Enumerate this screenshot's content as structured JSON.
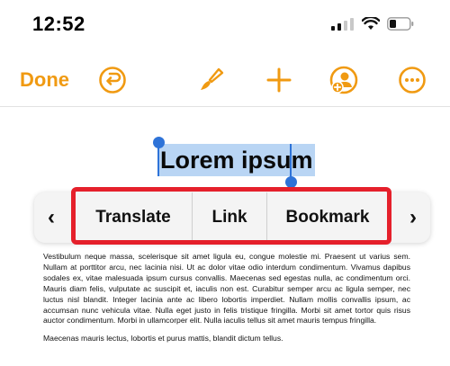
{
  "status_bar": {
    "time": "12:52"
  },
  "toolbar": {
    "done_label": "Done"
  },
  "document": {
    "title": "Lorem ipsum",
    "paragraphs": [
      "Vestibulum neque massa, scelerisque sit amet ligula eu, congue molestie mi. Praesent ut varius sem. Nullam at porttitor arcu, nec lacinia nisi. Ut ac dolor vitae odio interdum condimentum. Vivamus dapibus sodales ex, vitae malesuada ipsum cursus convallis. Maecenas sed egestas nulla, ac condimentum orci. Mauris diam felis, vulputate ac suscipit et, iaculis non est. Curabitur semper arcu ac ligula semper, nec luctus nisl blandit. Integer lacinia ante ac libero lobortis imperdiet. Nullam mollis convallis ipsum, ac accumsan nunc vehicula vitae. Nulla eget justo in felis tristique fringilla. Morbi sit amet tortor quis risus auctor condimentum. Morbi in ullamcorper elit. Nulla iaculis tellus sit amet mauris tempus fringilla.",
      "Maecenas mauris lectus, lobortis et purus mattis, blandit dictum tellus."
    ]
  },
  "context_menu": {
    "items": [
      {
        "label": "Translate"
      },
      {
        "label": "Link"
      },
      {
        "label": "Bookmark"
      }
    ],
    "prev_arrow": "‹",
    "next_arrow": "›"
  },
  "colors": {
    "accent": "#F09A12",
    "selection": "#2E73D8",
    "highlight_box": "#E5202B"
  },
  "icons": [
    "undo-icon",
    "paintbrush-icon",
    "plus-icon",
    "add-collaborator-icon",
    "more-icon",
    "signal-icon",
    "wifi-icon",
    "battery-icon"
  ]
}
